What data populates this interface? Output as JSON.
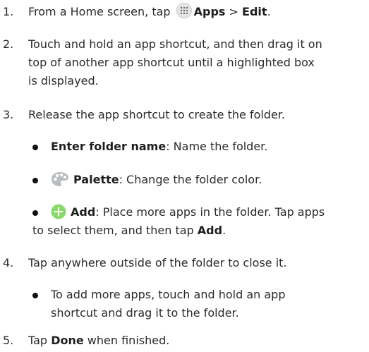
{
  "steps": [
    {
      "number": "1.",
      "pre": "From a Home screen, tap",
      "apps_label": "Apps",
      "separator": ">",
      "edit_label": "Edit",
      "post": "."
    },
    {
      "number": "2.",
      "line1": "Touch and hold an app shortcut, and then drag it on",
      "line2": "top of another app shortcut until a highlighted box",
      "line3": "is displayed."
    },
    {
      "number": "3.",
      "text": "Release the app shortcut to create the folder."
    },
    {
      "number": "4.",
      "text": "Tap anywhere outside of the folder to close it."
    },
    {
      "number": "5.",
      "pre": "Tap",
      "done_label": "Done",
      "post": "when finished."
    }
  ],
  "step3_bullets": {
    "folder_name": {
      "bold": "Enter folder name",
      "text": ": Name the folder."
    },
    "palette": {
      "icon": "palette-icon",
      "bold": "Palette",
      "text": ": Change the folder color."
    },
    "add": {
      "icon": "add-circle-icon",
      "bold": "Add",
      "line1_text": ": Place more apps in the folder. Tap apps",
      "line2_pre": "to select them, and then tap",
      "line2_bold": "Add",
      "line2_post": "."
    }
  },
  "step4_bullet": {
    "line1": "To add more apps, touch and hold an app",
    "line2": "shortcut and drag it to the folder."
  },
  "colors": {
    "text": "#2b2b2b",
    "add_icon": "#8bd96b",
    "palette_icon": "#b9bcc0"
  }
}
